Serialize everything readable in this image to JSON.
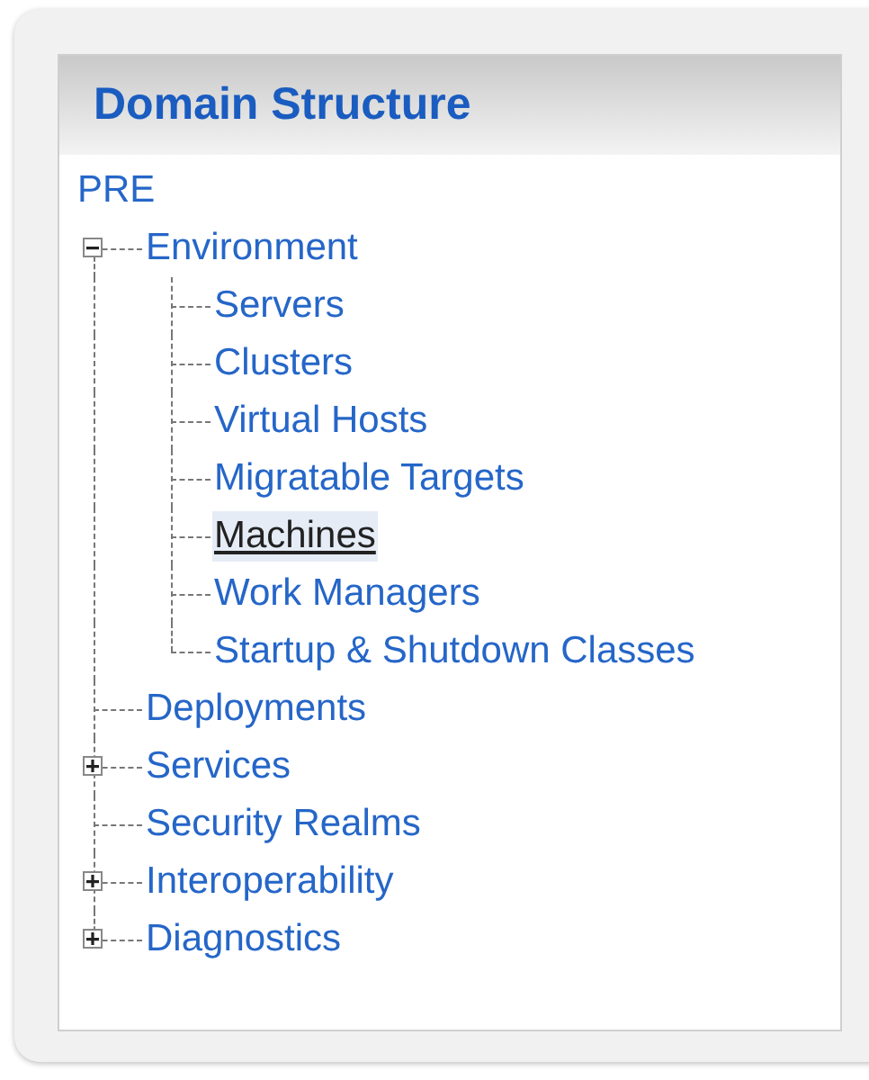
{
  "panel": {
    "title": "Domain Structure"
  },
  "tree": {
    "label": "PRE",
    "selected": false,
    "children": [
      {
        "label": "Environment",
        "selected": false,
        "expanded": true,
        "children": [
          {
            "label": "Servers",
            "selected": false
          },
          {
            "label": "Clusters",
            "selected": false
          },
          {
            "label": "Virtual Hosts",
            "selected": false
          },
          {
            "label": "Migratable Targets",
            "selected": false
          },
          {
            "label": "Machines",
            "selected": true
          },
          {
            "label": "Work Managers",
            "selected": false
          },
          {
            "label": "Startup & Shutdown Classes",
            "selected": false
          }
        ]
      },
      {
        "label": "Deployments",
        "selected": false
      },
      {
        "label": "Services",
        "selected": false,
        "expanded": false
      },
      {
        "label": "Security Realms",
        "selected": false
      },
      {
        "label": "Interoperability",
        "selected": false,
        "expanded": false
      },
      {
        "label": "Diagnostics",
        "selected": false,
        "expanded": false
      }
    ]
  }
}
